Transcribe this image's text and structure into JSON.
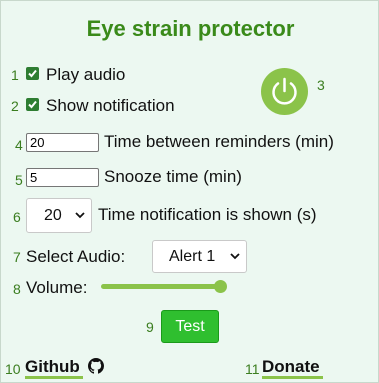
{
  "title": "Eye strain protector",
  "numbers": [
    "1",
    "2",
    "3",
    "4",
    "5",
    "6",
    "7",
    "8",
    "9",
    "10",
    "11"
  ],
  "play_audio": {
    "label": "Play audio",
    "checked": true
  },
  "show_notification": {
    "label": "Show notification",
    "checked": true
  },
  "power_button": {
    "icon": "power-icon"
  },
  "time_between": {
    "value": "20",
    "label": "Time between reminders (min)"
  },
  "snooze": {
    "value": "5",
    "label": "Snooze time (min)"
  },
  "notification_time": {
    "selected": "20",
    "label": "Time notification is shown (s)"
  },
  "audio": {
    "label": "Select Audio:",
    "selected": "Alert 1"
  },
  "volume": {
    "label": "Volume:",
    "level_percent": 100
  },
  "test_button": {
    "label": "Test"
  },
  "github": {
    "label": "Github",
    "icon": "github-icon"
  },
  "donate": {
    "label": "Donate"
  },
  "colors": {
    "background": "#ecf8f1",
    "title": "#3a8a1a",
    "accent": "#8bc34a",
    "button": "#2fbf2f",
    "checkbox": "#2e7d32"
  }
}
